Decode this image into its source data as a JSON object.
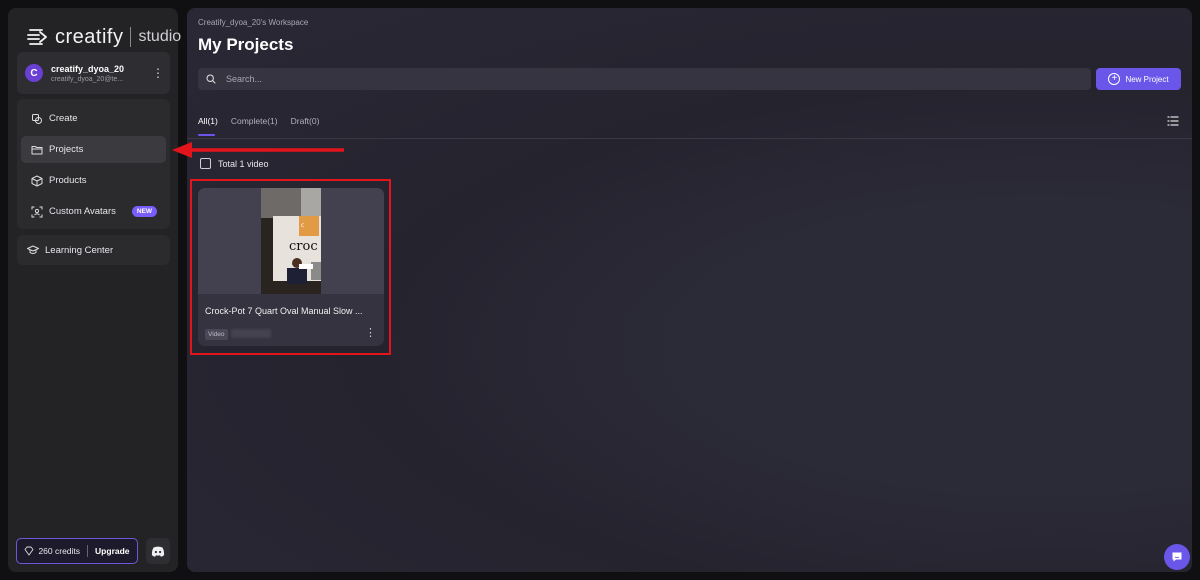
{
  "brand": {
    "name": "creatify",
    "product": "studio"
  },
  "account": {
    "initial": "C",
    "name": "creatify_dyoa_20",
    "email": "creatify_dyoa_20@te..."
  },
  "nav": {
    "items": [
      {
        "label": "Create",
        "icon": "create-icon"
      },
      {
        "label": "Projects",
        "icon": "folder-icon",
        "active": true
      },
      {
        "label": "Products",
        "icon": "box-icon"
      },
      {
        "label": "Custom Avatars",
        "icon": "avatar-scan-icon",
        "badge": "NEW"
      }
    ],
    "learning_center": "Learning Center"
  },
  "credits": {
    "label": "260 credits",
    "upgrade": "Upgrade"
  },
  "main": {
    "workspace": "Creatify_dyoa_20's Workspace",
    "title": "My Projects",
    "search_placeholder": "Search...",
    "new_project": "New Project",
    "tabs": [
      {
        "label": "All(1)",
        "active": true
      },
      {
        "label": "Complete(1)"
      },
      {
        "label": "Draft(0)"
      }
    ],
    "total": "Total 1 video",
    "projects": [
      {
        "title": "Crock-Pot 7 Quart Oval Manual Slow ...",
        "type": "Video"
      }
    ]
  },
  "colors": {
    "accent": "#6a57ea",
    "highlight": "#e4141c"
  }
}
